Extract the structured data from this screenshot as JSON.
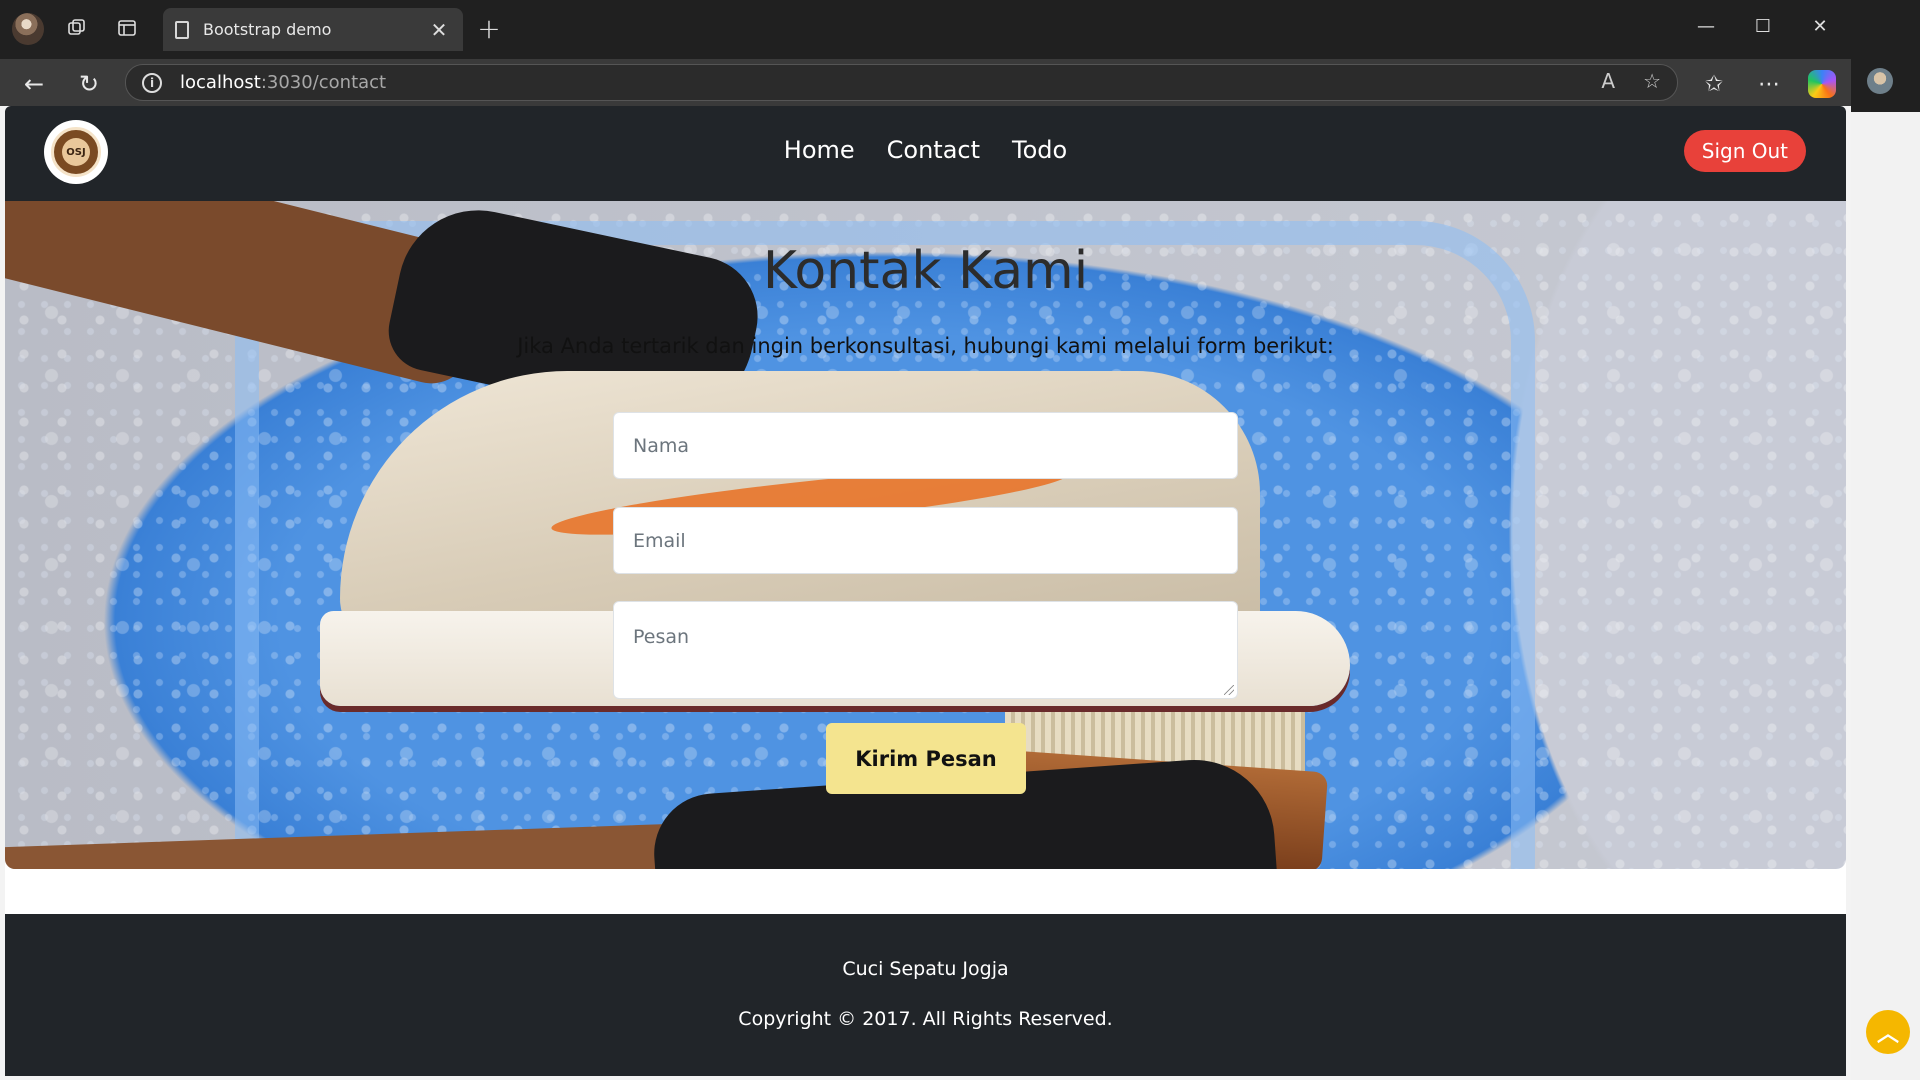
{
  "browser": {
    "tab_title": "Bootstrap demo",
    "url_host": "localhost",
    "url_path": ":3030/contact"
  },
  "site": {
    "nav": {
      "items": [
        {
          "label": "Home"
        },
        {
          "label": "Contact"
        },
        {
          "label": "Todo"
        }
      ],
      "signout_label": "Sign Out",
      "logo_text": "OSJ"
    },
    "hero": {
      "title": "Kontak Kami",
      "subtitle": "Jika Anda tertarik dan ingin berkonsultasi, hubungi kami melalui form berikut:",
      "form": {
        "name_placeholder": "Nama",
        "email_placeholder": "Email",
        "message_placeholder": "Pesan",
        "submit_label": "Kirim Pesan"
      }
    },
    "footer": {
      "brand": "Cuci Sepatu Jogja",
      "copyright": "Copyright © 2017. All Rights Reserved."
    }
  },
  "colors": {
    "navbar_bg": "#212529",
    "signout_bg": "#e8413a",
    "submit_bg": "#f4e48f",
    "scroll_top_bg": "#f5b700"
  }
}
